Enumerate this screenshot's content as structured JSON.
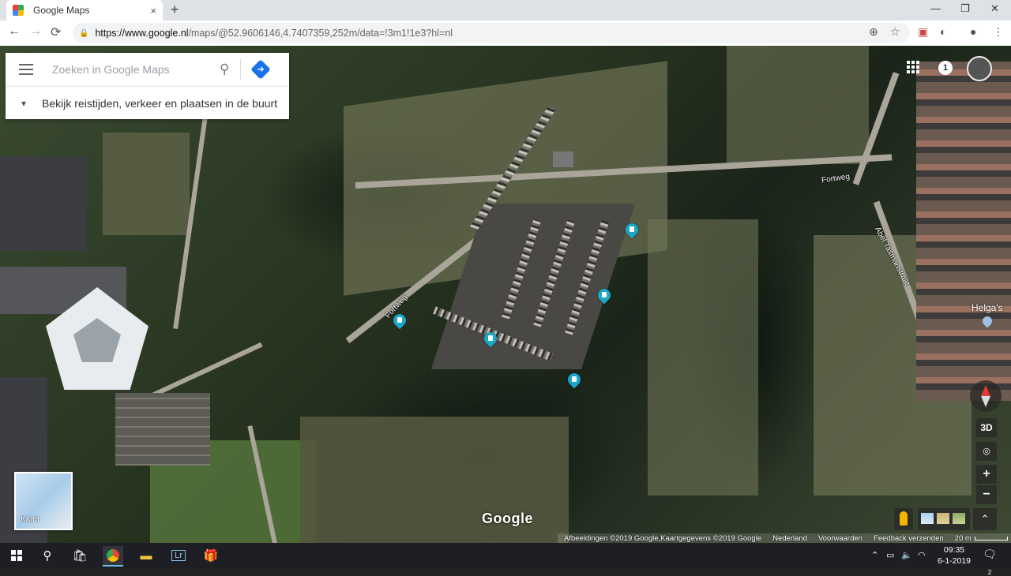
{
  "browser": {
    "tab_title": "Google Maps",
    "tab_close": "×",
    "new_tab": "+",
    "url_host": "https://www.google.nl",
    "url_path": "/maps/@52.9606146,4.7407359,252m/data=!3m1!1e3?hl=nl",
    "back": "←",
    "forward": "→",
    "reload": "⟳",
    "minimize": "—",
    "maximize": "❐",
    "close": "✕"
  },
  "search": {
    "placeholder": "Zoeken in Google Maps",
    "explore_text": "Bekijk reistijden, verkeer en plaatsen in de buurt"
  },
  "map": {
    "road_labels": [
      "Fortweg",
      "Fortweg",
      "Abel Tasmanstraat"
    ],
    "place_label": "Helga's",
    "watermark": "Google",
    "pin_color": "#1aa6c7",
    "notification_count": "1",
    "minimap_label": "Kaart",
    "ctrl_3d": "3D",
    "zoom_in": "+",
    "zoom_out": "−",
    "expand": "⌃"
  },
  "footer": {
    "attribution": "Afbeeldingen ©2019 Google,Kaartgegevens ©2019 Google",
    "country": "Nederland",
    "terms": "Voorwaarden",
    "feedback": "Feedback verzenden",
    "scale": "20 m"
  },
  "taskbar": {
    "time": "09:35",
    "date": "6-1-2019",
    "lr_label": "Lr",
    "notifications": "2"
  }
}
